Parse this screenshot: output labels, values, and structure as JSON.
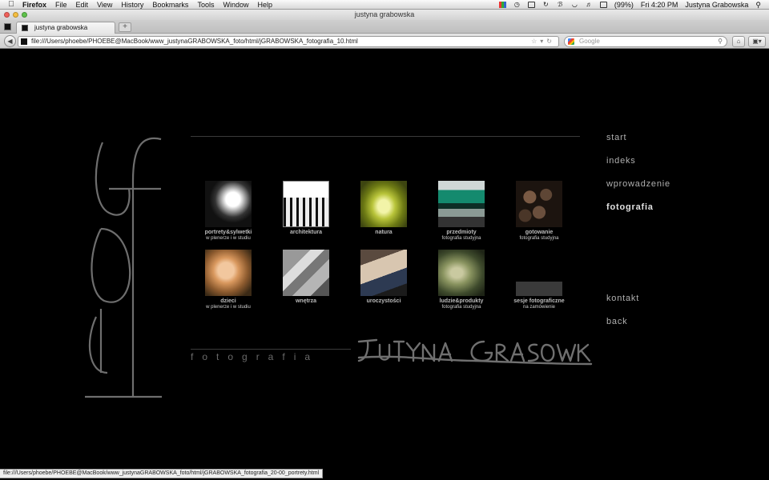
{
  "menubar": {
    "app": "Firefox",
    "items": [
      "File",
      "Edit",
      "View",
      "History",
      "Bookmarks",
      "Tools",
      "Window",
      "Help"
    ],
    "battery": "(99%)",
    "clock": "Fri 4:20 PM",
    "user": "Justyna Grabowska"
  },
  "window": {
    "title": "justyna grabowska"
  },
  "tabs": [
    {
      "label": "justyna grabowska"
    }
  ],
  "toolbar": {
    "url": "file:///Users/phoebe/PHOEBE@MacBook/www_justynaGRABOWSKA_foto/html/jGRABOWSKA_fotografia_10.html",
    "search_placeholder": "Google"
  },
  "site": {
    "subtitle": "fotografia",
    "gallery": [
      {
        "title": "portrety&sylwetki",
        "sub": "w plenerze i w studiu",
        "photo": "portrait"
      },
      {
        "title": "architektura",
        "sub": "",
        "photo": "architecture"
      },
      {
        "title": "natura",
        "sub": "",
        "photo": "nature"
      },
      {
        "title": "przedmioty",
        "sub": "fotografia studyjna",
        "photo": "objects"
      },
      {
        "title": "gotowanie",
        "sub": "fotografia studyjna",
        "photo": "cooking"
      },
      {
        "title": "dzieci",
        "sub": "w plenerze i w studiu",
        "photo": "children"
      },
      {
        "title": "wnętrza",
        "sub": "",
        "photo": "interiors"
      },
      {
        "title": "uroczystości",
        "sub": "",
        "photo": "ceremonies"
      },
      {
        "title": "ludzie&produkty",
        "sub": "fotografia studyjna",
        "photo": "products"
      },
      {
        "title": "sesje fotograficzne",
        "sub": "na zamówienie",
        "photo": "placeholder"
      }
    ],
    "nav": [
      {
        "label": "start",
        "active": false
      },
      {
        "label": "indeks",
        "active": false
      },
      {
        "label": "wprowadzenie",
        "active": false
      },
      {
        "label": "fotografia",
        "active": true
      },
      {
        "label": "kontakt",
        "active": false
      },
      {
        "label": "back",
        "active": false
      }
    ]
  },
  "statusbar": {
    "text": "file:///Users/phoebe/PHOEBE@MacBook/www_justynaGRABOWSKA_foto/html/jGRABOWSKA_fotografia_20-00_portrety.html"
  }
}
